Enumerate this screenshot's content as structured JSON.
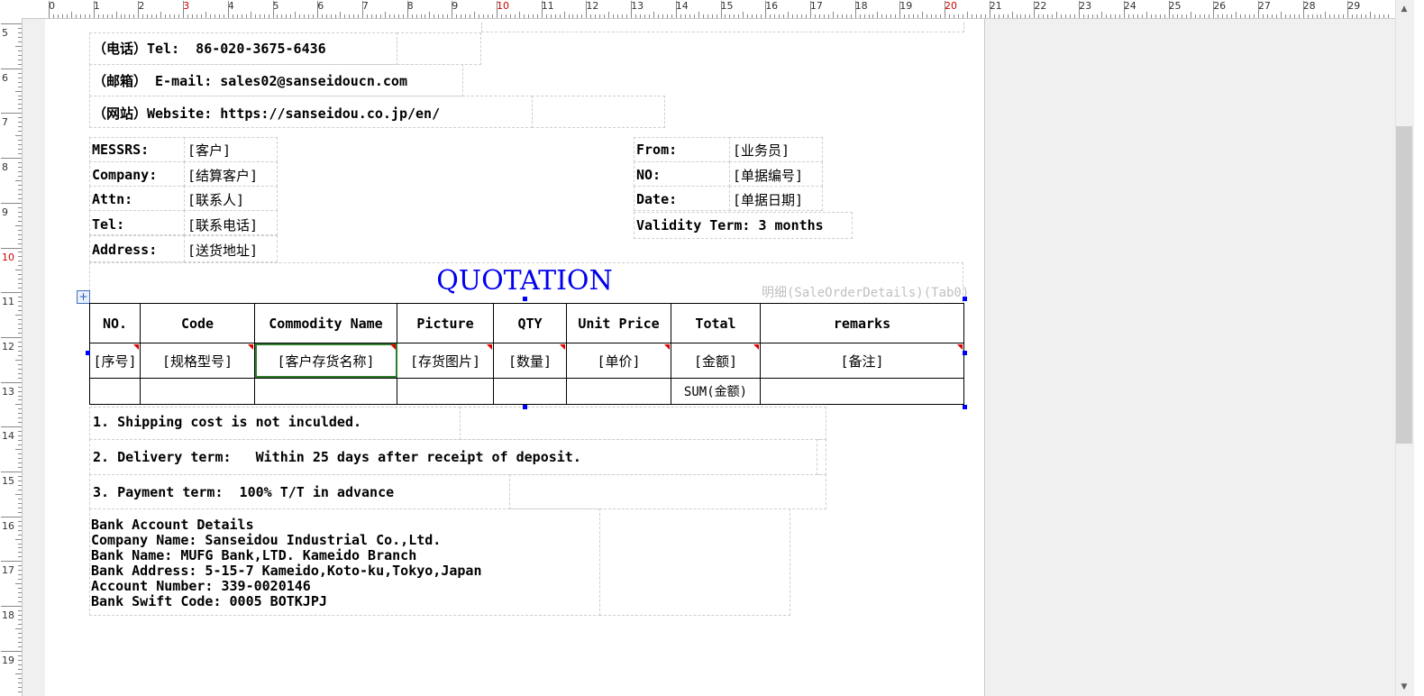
{
  "ruler": {
    "h_labels": [
      "0",
      "1",
      "2",
      "3",
      "4",
      "5",
      "6",
      "7",
      "8",
      "9",
      "10",
      "11",
      "12",
      "13",
      "14",
      "15",
      "16",
      "17",
      "18",
      "19",
      "20",
      "21",
      "22",
      "23",
      "24",
      "25",
      "26",
      "27",
      "28",
      "29",
      "3"
    ],
    "v_labels": [
      "5",
      "6",
      "7",
      "8",
      "9",
      "10",
      "11",
      "12",
      "13",
      "14",
      "15",
      "16",
      "17",
      "18",
      "19"
    ],
    "highlight_color": "#d00000"
  },
  "header": {
    "tel": "（电话）Tel:  86-020-3675-6436",
    "email": "（邮箱） E-mail: sales02@sanseidoucn.com",
    "website": "（网站）Website: https://sanseidou.co.jp/en/"
  },
  "customer": {
    "messrs_label": "MESSRS:",
    "messrs_value": "[客户]",
    "company_label": "Company:",
    "company_value": "[结算客户]",
    "attn_label": "Attn:",
    "attn_value": "[联系人]",
    "tel_label": "Tel:",
    "tel_value": "[联系电话]",
    "address_label": "Address:",
    "address_value": "[送货地址]"
  },
  "sender": {
    "from_label": "From:",
    "from_value": "[业务员]",
    "no_label": "NO:",
    "no_value": "[单据编号]",
    "date_label": "Date:",
    "date_value": "[单据日期]",
    "validity": "Validity Term: 3 months"
  },
  "title": "QUOTATION",
  "title_color": "#0000ee",
  "details_caption": "明细(SaleOrderDetails)(Tab0)",
  "table": {
    "headers": [
      "NO.",
      "Code",
      "Commodity Name",
      "Picture",
      "QTY",
      "Unit Price",
      "Total",
      "remarks"
    ],
    "row": [
      "[序号]",
      "[规格型号]",
      "[客户存货名称]",
      "[存货图片]",
      "[数量]",
      "[单价]",
      "[金额]",
      "[备注]"
    ],
    "sum_label": "SUM(金额)"
  },
  "terms": {
    "t1": "1. Shipping cost is not inculded.",
    "t2": "2. Delivery term:   Within 25 days after receipt of deposit.",
    "t3": "3. Payment term:  100% T/T in advance"
  },
  "bank": {
    "title": "Bank Account Details",
    "company": "Company Name: Sanseidou Industrial Co.,Ltd.",
    "bank_name": "Bank Name: MUFG Bank,LTD. Kameido Branch",
    "address": "Bank Address: 5-15-7 Kameido,Koto-ku,Tokyo,Japan",
    "account": "Account Number: 339-0020146",
    "swift": "Bank Swift Code: 0005 BOTKJPJ"
  },
  "icons": {
    "move_handle": "+",
    "scroll_up": "▲",
    "scroll_down": "▼"
  }
}
